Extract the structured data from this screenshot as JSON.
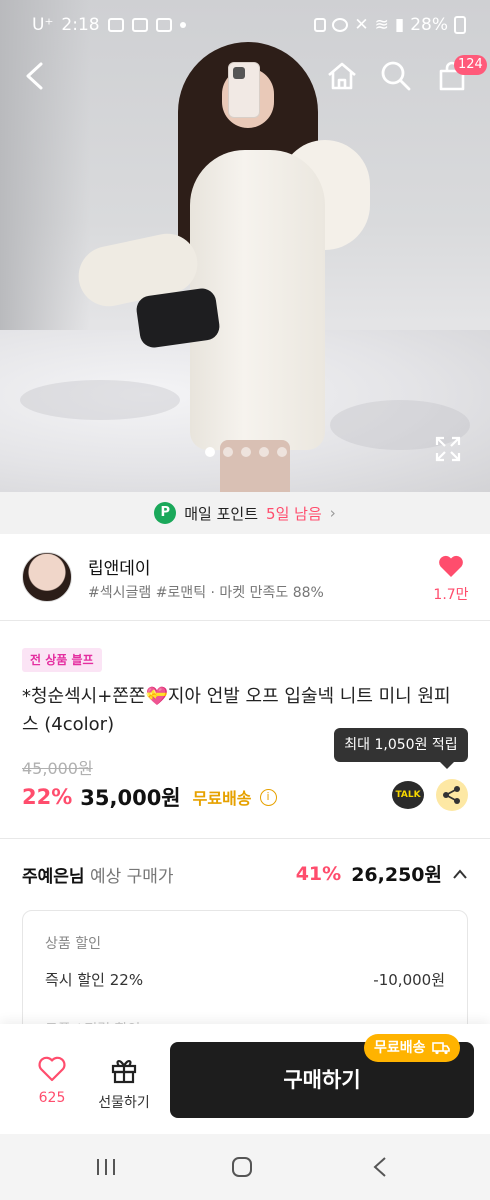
{
  "status_bar": {
    "carrier": "U⁺",
    "time": "2:18",
    "battery": "28%"
  },
  "header": {
    "cart_count": "124"
  },
  "gallery": {
    "slide_count": 5,
    "active_slide": 1
  },
  "points_banner": {
    "label": "매일 포인트",
    "highlight": "5일 남음",
    "icon_letter": "P"
  },
  "shop": {
    "name": "립앤데이",
    "tags": "#섹시글램 #로맨틱 · 마켓 만족도 88%",
    "like_count": "1.7만"
  },
  "product": {
    "promo_badge": "전 상품 블프",
    "title": "*청순섹시+쫀쫀💝지아 언발 오프 입술넥 니트 미니 원피스 (4color)",
    "tooltip": "최대 1,050원 적립",
    "original_price": "45,000원",
    "discount_rate": "22%",
    "price": "35,000원",
    "shipping": "무료배송",
    "talk_label": "TALK"
  },
  "expected_price": {
    "user_name": "주예은님",
    "label": "예상 구매가",
    "discount_rate": "41%",
    "price": "26,250원"
  },
  "discount_card": {
    "heading": "상품 할인",
    "rows": [
      {
        "label": "즉시 할인 22%",
        "amount": "-10,000원"
      }
    ],
    "partial_row": "쿠폰 / 적립 할인"
  },
  "action_bar": {
    "like_count": "625",
    "gift_label": "선물하기",
    "buy_label": "구매하기",
    "free_badge": "무료배송"
  },
  "colors": {
    "accent_pink": "#ff4d6d",
    "shipping_yellow": "#e6a100",
    "buy_button": "#1d1d1d"
  }
}
